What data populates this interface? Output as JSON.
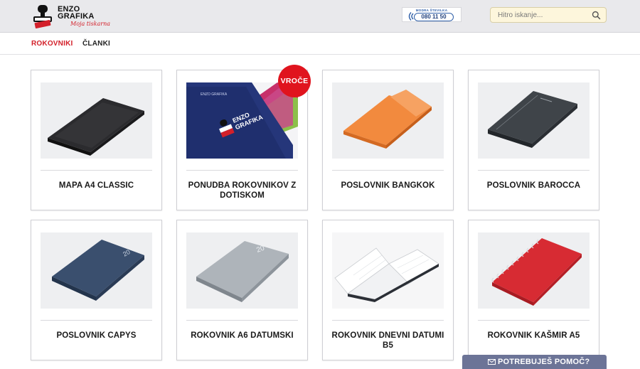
{
  "header": {
    "logo": {
      "line1": "ENZO",
      "line2": "GRAFIKA",
      "tagline": "Moja tiskarna"
    },
    "hotline": {
      "caption": "MODRA ŠTEVILKA",
      "number": "080 11 50"
    },
    "search": {
      "placeholder": "Hitro iskanje...",
      "value": ""
    }
  },
  "nav": {
    "items": [
      {
        "label": "ROKOVNIKI",
        "active": true
      },
      {
        "label": "ČLANKI",
        "active": false
      }
    ]
  },
  "products": [
    {
      "title": "MAPA A4 CLASSIC",
      "image": "black-folder"
    },
    {
      "title": "PONUDBA ROKOVNIKOV Z DOTISKOM",
      "image": "navy-notebooks-logo",
      "badge": "VROČE"
    },
    {
      "title": "POSLOVNIK BANGKOK",
      "image": "orange-notebook"
    },
    {
      "title": "POSLOVNIK BAROCCA",
      "image": "grey-notebook"
    },
    {
      "title": "POSLOVNIK CAPYS",
      "image": "blue-notebook"
    },
    {
      "title": "ROKOVNIK A6 DATUMSKI",
      "image": "silver-notebook"
    },
    {
      "title": "ROKOVNIK DNEVNI DATUMI B5",
      "image": "open-diary"
    },
    {
      "title": "ROKOVNIK KAŠMIR A5",
      "image": "red-spiral-notebook"
    }
  ],
  "help": {
    "label": "POTREBUJEŠ POMOČ?"
  },
  "colors": {
    "accent": "#d3202a",
    "badge": "#e0141e",
    "help_bar": "#6c7497",
    "search_bg": "#fdf6dc"
  }
}
